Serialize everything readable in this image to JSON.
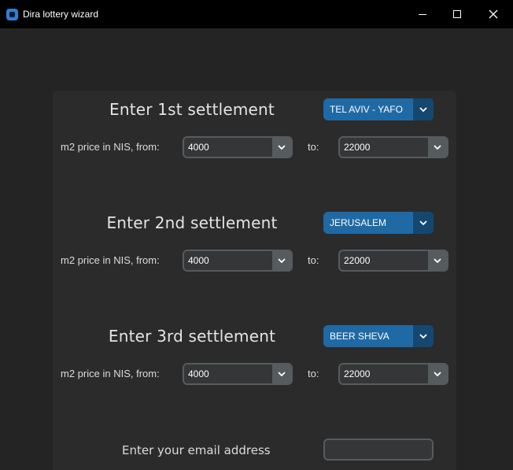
{
  "window": {
    "title": "Dira lottery wizard"
  },
  "settlements": [
    {
      "heading": "Enter 1st settlement",
      "city": "TEL AVIV - YAFO",
      "from_label": "m2 price in NIS, from:",
      "from_value": "4000",
      "to_label": "to:",
      "to_value": "22000"
    },
    {
      "heading": "Enter 2nd settlement",
      "city": "JERUSALEM",
      "from_label": "m2 price in NIS, from:",
      "from_value": "4000",
      "to_label": "to:",
      "to_value": "22000"
    },
    {
      "heading": "Enter 3rd settlement",
      "city": "BEER SHEVA",
      "from_label": "m2 price in NIS, from:",
      "from_value": "4000",
      "to_label": "to:",
      "to_value": "22000"
    }
  ],
  "email": {
    "label": "Enter your email address",
    "value": ""
  },
  "colors": {
    "accent": "#1f6aa5",
    "accent_dark": "#144870",
    "panel": "#2b2b2b",
    "background": "#242424"
  }
}
